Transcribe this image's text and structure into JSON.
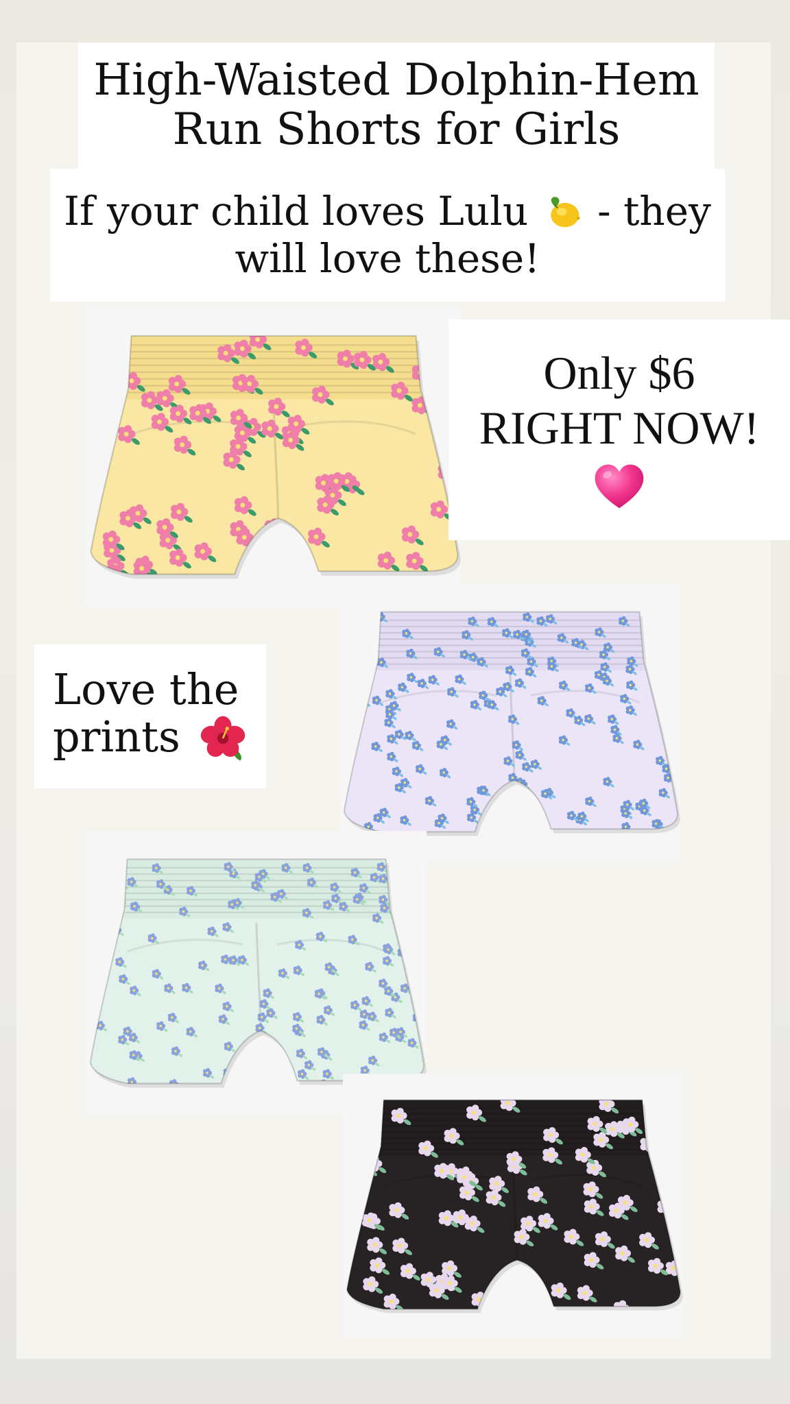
{
  "title": {
    "line1": "High-Waisted Dolphin-Hem",
    "line2": "Run Shorts for Girls"
  },
  "subtitle": {
    "line1_before_icon": "If your child loves Lulu",
    "line1_after_icon": "- they",
    "line2": "will love these!",
    "icon": "lemon-icon"
  },
  "price": {
    "line1": "Only $6",
    "line2": "RIGHT NOW!",
    "icon": "pink-heart-icon",
    "icon_color": "#f2368f"
  },
  "prints": {
    "line1": "Love the",
    "line2": "prints",
    "icon": "hibiscus-icon"
  },
  "products": [
    {
      "name": "yellow-floral-shorts",
      "fabric": "#f9e7a3",
      "band": "#f4de8e",
      "flower": "#ef7fa8",
      "leaf": "#3b9b6a"
    },
    {
      "name": "lavender-floral-shorts",
      "fabric": "#ebe5f7",
      "band": "#e2dbf2",
      "flower": "#6f97d9",
      "leaf": "#7dbfe6"
    },
    {
      "name": "mint-floral-shorts",
      "fabric": "#e2f2ea",
      "band": "#d9ece2",
      "flower": "#8aa2dc",
      "leaf": "#a8dcb8"
    },
    {
      "name": "black-floral-shorts",
      "fabric": "#272224",
      "band": "#221d1f",
      "flower": "#e8d8ee",
      "leaf": "#7fbd98"
    }
  ]
}
